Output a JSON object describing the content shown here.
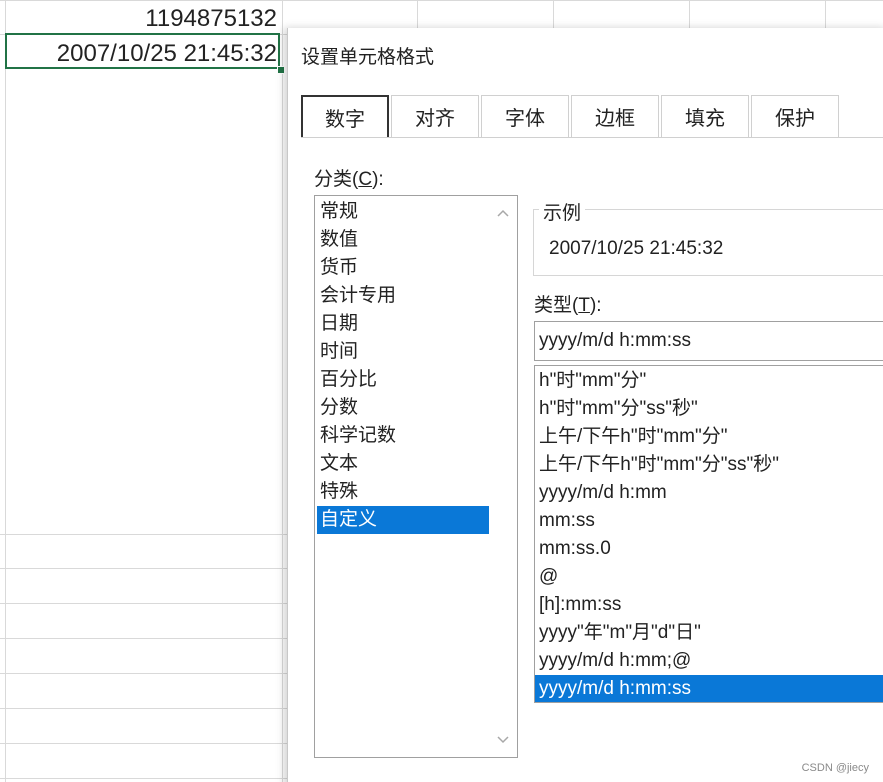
{
  "sheet": {
    "cell_value_1": "1194875132",
    "cell_value_2": "2007/10/25 21:45:32"
  },
  "dialog": {
    "title": "设置单元格格式",
    "tabs": [
      {
        "label": "数字"
      },
      {
        "label": "对齐"
      },
      {
        "label": "字体"
      },
      {
        "label": "边框"
      },
      {
        "label": "填充"
      },
      {
        "label": "保护"
      }
    ],
    "active_tab": "数字",
    "category_label_text": "分类(",
    "category_label_key": "C",
    "category_label_end": "):",
    "categories": [
      "常规",
      "数值",
      "货币",
      "会计专用",
      "日期",
      "时间",
      "百分比",
      "分数",
      "科学记数",
      "文本",
      "特殊",
      "自定义"
    ],
    "selected_category": "自定义",
    "sample_label": "示例",
    "sample_value": "2007/10/25 21:45:32",
    "type_label_text": "类型(",
    "type_label_key": "T",
    "type_label_end": "):",
    "type_input_value": "yyyy/m/d h:mm:ss",
    "formats": [
      "h\"时\"mm\"分\"",
      "h\"时\"mm\"分\"ss\"秒\"",
      "上午/下午h\"时\"mm\"分\"",
      "上午/下午h\"时\"mm\"分\"ss\"秒\"",
      "yyyy/m/d h:mm",
      "mm:ss",
      "mm:ss.0",
      "@",
      "[h]:mm:ss",
      "yyyy\"年\"m\"月\"d\"日\"",
      "yyyy/m/d h:mm;@",
      "yyyy/m/d h:mm:ss"
    ],
    "selected_format": "yyyy/m/d h:mm:ss"
  },
  "watermark": "CSDN @jiecy",
  "colors": {
    "selection": "#0a78d7",
    "active_cell_border": "#217346"
  }
}
